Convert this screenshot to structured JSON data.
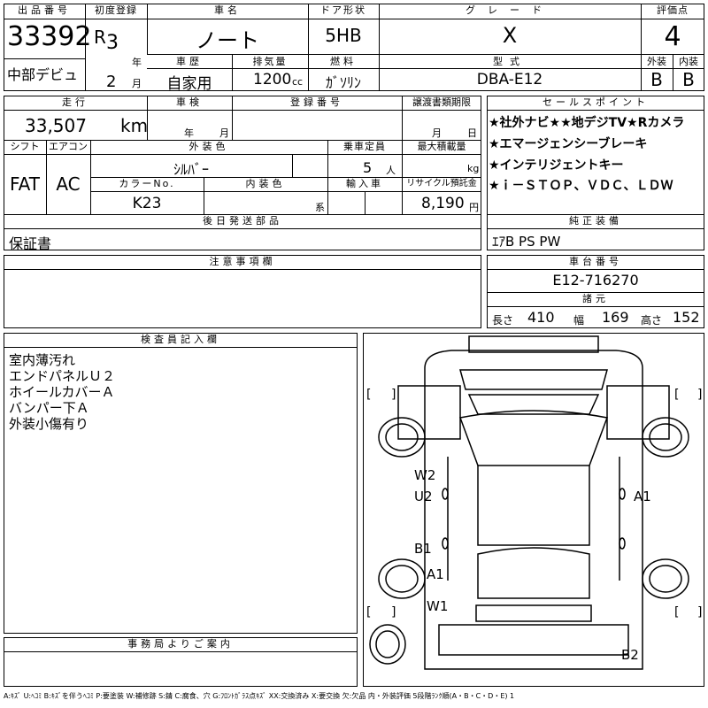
{
  "header": {
    "lot_label": "出品番号",
    "lot_number": "33392",
    "venue": "中部デビュ",
    "first_reg_label": "初度登録",
    "era": "R",
    "year": "3",
    "year_unit": "年",
    "month": "2",
    "month_unit": "月",
    "car_name_label": "車名",
    "car_name": "ノート",
    "door_label": "ドア形状",
    "door": "5HB",
    "grade_label": "グレード",
    "grade": "X",
    "score_label": "評価点",
    "score": "4",
    "exterior_label": "外装",
    "exterior": "B",
    "interior_label": "内装",
    "interior": "B",
    "history_label": "車歴",
    "history": "自家用",
    "displacement_label": "排気量",
    "displacement": "1200",
    "displacement_unit": "cc",
    "fuel_label": "燃料",
    "fuel": "ｶﾞｿﾘﾝ",
    "model_label": "型式",
    "model": "DBA-E12"
  },
  "row2": {
    "mileage_label": "走行",
    "mileage": "33,507",
    "mileage_unit": "km",
    "inspection_label": "車検",
    "inspection_year_unit": "年",
    "inspection_month_unit": "月",
    "reg_no_label": "登録番号",
    "transfer_label": "譲渡書類期限",
    "transfer_month_unit": "月",
    "transfer_day_unit": "日",
    "shift_label": "シフト",
    "shift": "FAT",
    "ac_label": "エアコン",
    "ac": "AC",
    "color_label": "外装色",
    "color": "ｼﾙﾊﾞｰ",
    "capacity_label": "乗車定員",
    "capacity": "5",
    "capacity_unit": "人",
    "load_label": "最大積載量",
    "load_unit": "kg",
    "color_no_label": "カラーNo.",
    "color_no": "K23",
    "int_color_label": "内装色",
    "int_color_unit": "系",
    "import_label": "輸入車",
    "recycle_label": "リサイクル預託金",
    "recycle": "8,190",
    "recycle_unit": "円",
    "later_label": "後日発送部品",
    "later": "保証書"
  },
  "selling_points": {
    "label": "セールスポイント",
    "items": [
      "★社外ナビ★★地デジTV★Rカメラ",
      "★エマージェンシーブレーキ",
      "★インテリジェントキー",
      "★ｉ－ＳＴＯＰ、ＶＤＣ、ＬＤＷ"
    ]
  },
  "equipment": {
    "label": "純正装備",
    "value": "ｴｱB PS PW"
  },
  "notes": {
    "label": "注意事項欄"
  },
  "chassis": {
    "label": "車台番号",
    "value": "E12-716270",
    "spec_label": "諸元",
    "length_label": "長さ",
    "length": "410",
    "width_label": "幅",
    "width": "169",
    "height_label": "高さ",
    "height": "152"
  },
  "inspector": {
    "label": "検査員記入欄",
    "lines": [
      "室内薄汚れ",
      "エンドパネルＵ２",
      "ホイールカバーＡ",
      "バンパー下Ａ",
      "外装小傷有り"
    ]
  },
  "office": {
    "label": "事務局よりご案内"
  },
  "diagram": {
    "marks": [
      "W2",
      "U2",
      "A1",
      "B1",
      "A1",
      "W1",
      "B2"
    ]
  },
  "legend": "A:ｷｽﾞ U:ﾍｺﾐ B:ｷｽﾞを伴うﾍｺﾐ P:要塗装 W:補修跡 S:錆 C:腐食、穴 G:ﾌﾛﾝﾄｶﾞﾗｽ点ｷｽﾞ XX:交換済み X:要交換 欠:欠品 内・外装評価 5段階ﾗﾝｸ順(A・B・C・D・E) 1"
}
